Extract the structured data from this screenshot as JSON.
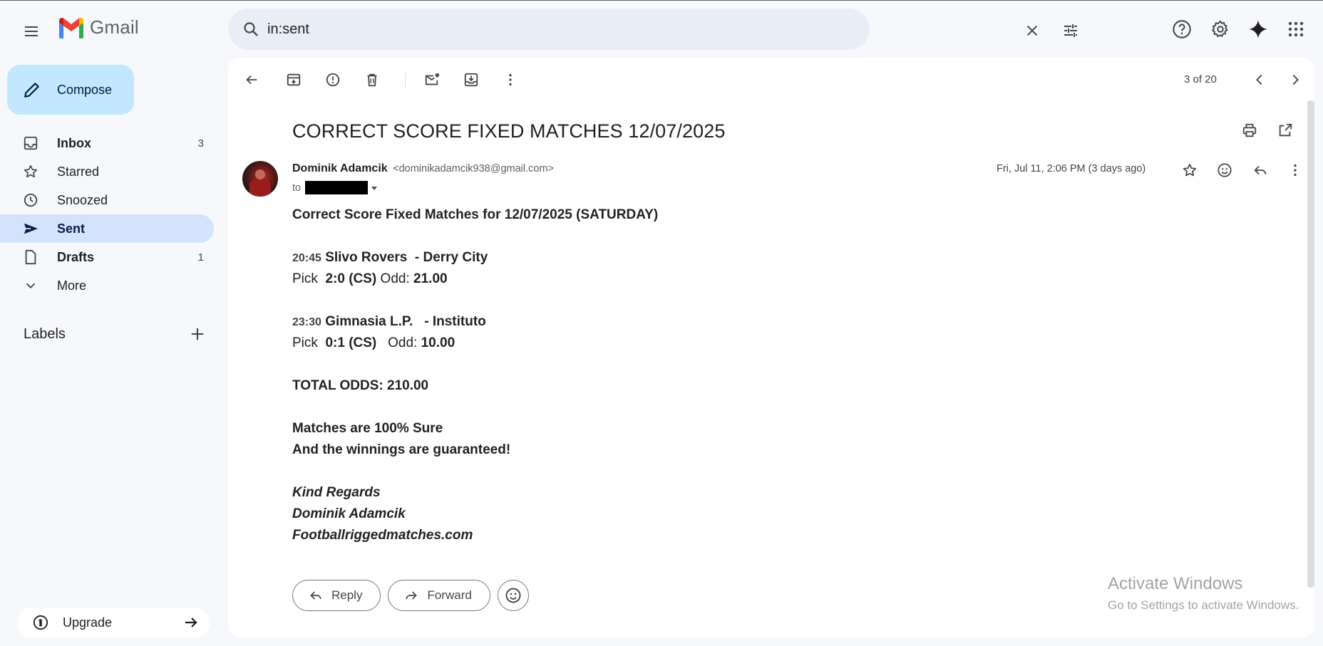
{
  "app": {
    "name": "Gmail"
  },
  "search": {
    "query": "in:sent"
  },
  "sidebar": {
    "compose_label": "Compose",
    "items": [
      {
        "label": "Inbox",
        "count": "3",
        "icon": "inbox-icon",
        "bold": true,
        "active": false
      },
      {
        "label": "Starred",
        "count": "",
        "icon": "star-icon",
        "bold": false,
        "active": false
      },
      {
        "label": "Snoozed",
        "count": "",
        "icon": "clock-icon",
        "bold": false,
        "active": false
      },
      {
        "label": "Sent",
        "count": "",
        "icon": "send-icon",
        "bold": true,
        "active": true
      },
      {
        "label": "Drafts",
        "count": "1",
        "icon": "draft-icon",
        "bold": true,
        "active": false
      },
      {
        "label": "More",
        "count": "",
        "icon": "chevron-down-icon",
        "bold": false,
        "active": false
      }
    ],
    "labels_title": "Labels",
    "upgrade_label": "Upgrade"
  },
  "toolbar": {
    "pager_text": "3 of 20"
  },
  "message": {
    "subject": "CORRECT SCORE FIXED MATCHES 12/07/2025",
    "sender_name": "Dominik Adamcik",
    "sender_email": "<dominikadamcik938@gmail.com>",
    "to_prefix": "to",
    "date": "Fri, Jul 11, 2:06 PM (3 days ago)",
    "body": {
      "heading": "Correct Score Fixed Matches for 12/07/2025 (SATURDAY)",
      "match1_time": "20:45",
      "match1_teams": "Slivo Rovers  - Derry City",
      "match1_pick_label": "Pick",
      "match1_pick": "2:0 (CS)",
      "match1_odd_label": "Odd:",
      "match1_odd": "21.00",
      "match2_time": "23:30",
      "match2_teams": "Gimnasia L.P.   - Instituto",
      "match2_pick_label": "Pick",
      "match2_pick": "0:1 (CS)",
      "match2_odd_label": "Odd:",
      "match2_odd": "10.00",
      "total": "TOTAL ODDS: 210.00",
      "sure": "Matches are 100% Sure",
      "guarantee": "And the winnings are guaranteed!",
      "regards": "Kind Regards",
      "signature_name": "Dominik Adamcik",
      "signature_site": "Footballriggedmatches.com"
    }
  },
  "actions": {
    "reply_label": "Reply",
    "forward_label": "Forward"
  },
  "watermark": {
    "line1": "Activate Windows",
    "line2": "Go to Settings to activate Windows."
  },
  "colors": {
    "background": "#f6f8fc",
    "compose": "#c2e7ff",
    "active_nav": "#d3e3fd",
    "search_bg": "#e9eef6",
    "gmail_red": "#ea4335",
    "gmail_blue": "#4285f4",
    "gmail_green": "#34a853",
    "gmail_yellow": "#fbbc04"
  }
}
